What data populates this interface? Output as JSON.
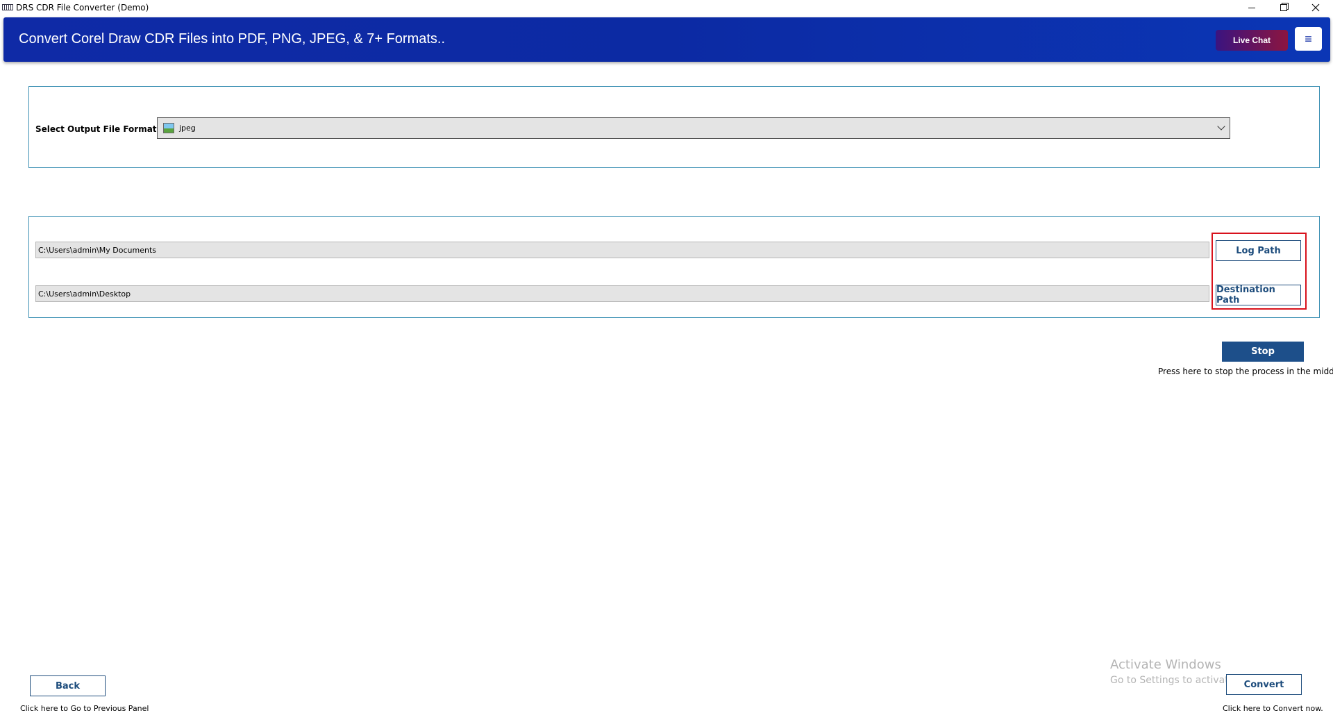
{
  "window": {
    "title": "DRS CDR File Converter (Demo)",
    "controls": [
      "minimize",
      "restore",
      "close"
    ]
  },
  "header": {
    "title": "Convert Corel Draw CDR Files into PDF, PNG, JPEG, & 7+ Formats..",
    "live_chat_label": "Live Chat",
    "menu_icon": "hamburger-icon",
    "menu_glyph": "≡"
  },
  "format": {
    "label": "Select Output File Format :",
    "selected": "jpeg",
    "icon": "image-file-icon"
  },
  "paths": {
    "log_path_value": "C:\\Users\\admin\\My Documents",
    "destination_path_value": "C:\\Users\\admin\\Desktop",
    "log_button_label": "Log Path",
    "destination_button_label": "Destination Path"
  },
  "process": {
    "stop_label": "Stop",
    "stop_hint": "Press here to stop the process in the middle."
  },
  "footer": {
    "back_label": "Back",
    "back_hint": "Click here to Go to Previous Panel",
    "convert_label": "Convert",
    "convert_hint": "Click here to Convert now."
  },
  "watermark": {
    "line1": "Activate Windows",
    "line2": "Go to Settings to activate Windows."
  },
  "colors": {
    "banner": "#0c2aa3",
    "accent_button": "#1d4f8a",
    "highlight_box": "#d8121c",
    "panel_border": "#3a8fb3"
  }
}
